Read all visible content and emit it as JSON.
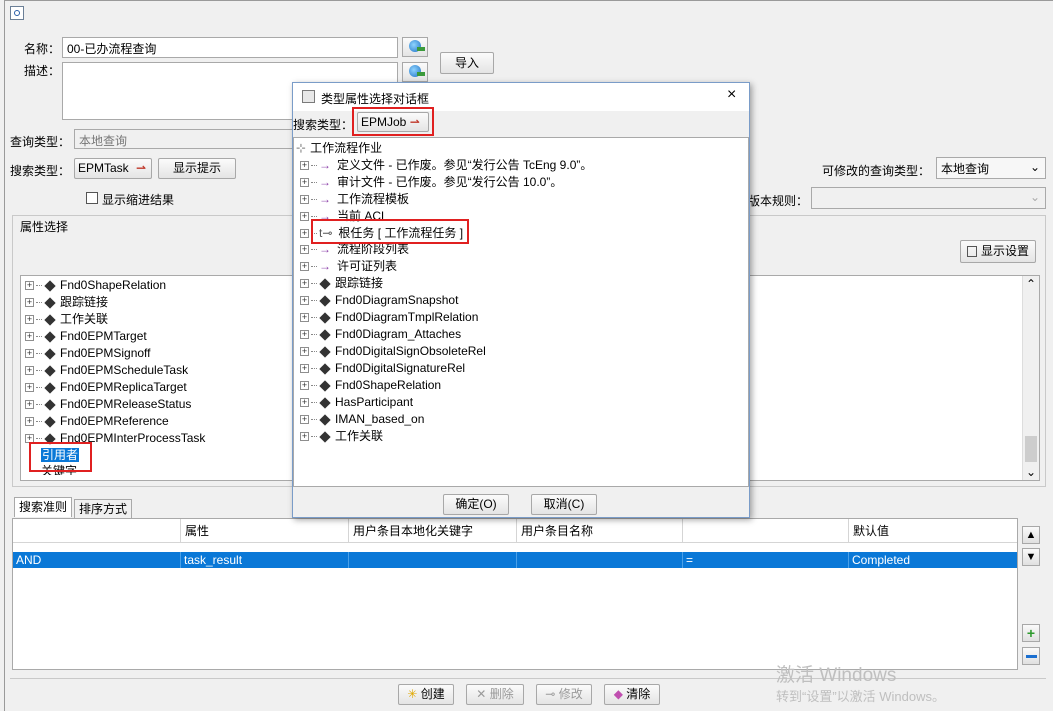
{
  "toolbar": {
    "icon": "search-query-icon"
  },
  "form": {
    "name_label": "名称：",
    "name_value": "00-已办流程查询",
    "desc_label": "描述：",
    "import_button": "导入",
    "query_source_label": "查询类型：",
    "query_source_value": "本地查询",
    "search_type_label": "搜索类型：",
    "search_type_value": "EPMTask",
    "show_hint_button": "显示提示",
    "show_indented_label": "显示缩进结果",
    "modifiable_label": "可修改的查询类型：",
    "modifiable_value": "本地查询",
    "rev_rule_label": "版本规则："
  },
  "attr_panel": {
    "title": "属性选择",
    "display_settings_button": "显示设置",
    "items": [
      "Fnd0ShapeRelation",
      "跟踪链接",
      "工作关联",
      "Fnd0EPMTarget",
      "Fnd0EPMSignoff",
      "Fnd0EPMScheduleTask",
      "Fnd0EPMReplicaTarget",
      "Fnd0EPMReleaseStatus",
      "Fnd0EPMReference",
      "Fnd0EPMInterProcessTask"
    ],
    "selected_item": "引用者",
    "partial_item": "关键字"
  },
  "dialog": {
    "title": "类型属性选择对话框",
    "close": "×",
    "search_type_label": "搜索类型：",
    "search_type_value": "EPMJob",
    "root": "工作流程作业",
    "items": [
      "定义文件 - 已作废。参见“发行公告 TcEng 9.0”。",
      "审计文件 - 已作废。参见“发行公告 10.0”。",
      "工作流程模板",
      "当前 ACL",
      "根任务 [ 工作流程任务 ]",
      "流程阶段列表",
      "许可证列表",
      "跟踪链接",
      "Fnd0DiagramSnapshot",
      "Fnd0DiagramTmplRelation",
      "Fnd0Diagram_Attaches",
      "Fnd0DigitalSignObsoleteRel",
      "Fnd0DigitalSignatureRel",
      "Fnd0ShapeRelation",
      "HasParticipant",
      "IMAN_based_on",
      "工作关联"
    ],
    "ok_button": "确定(O)",
    "cancel_button": "取消(C)"
  },
  "criteria": {
    "tab_search": "搜索准则",
    "tab_sort": "排序方式",
    "headers": [
      "",
      "属性",
      "用户条目本地化关键字",
      "用户条目名称",
      "",
      "默认值"
    ],
    "row": [
      "AND",
      "task_result",
      "",
      "",
      "=",
      "Completed"
    ]
  },
  "bottom_buttons": {
    "create": "创建",
    "delete": "删除",
    "modify": "修改",
    "clear": "清除"
  },
  "watermark": {
    "line1": "激活 Windows",
    "line2": "转到“设置”以激活 Windows。"
  },
  "colors": {
    "selection": "#0a78d7",
    "highlight": "#e02020"
  }
}
